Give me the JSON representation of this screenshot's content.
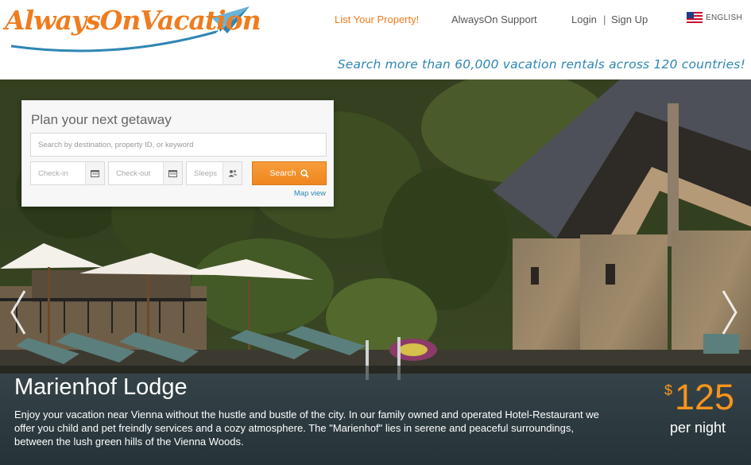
{
  "header": {
    "logo_text": "AlwaysOnVacation",
    "nav": {
      "list_property": "List Your Property!",
      "support": "AlwaysOn Support",
      "login": "Login",
      "separator": "|",
      "signup": "Sign Up"
    },
    "language": {
      "flag_icon": "us-flag-icon",
      "label": "ENGLISH"
    },
    "tagline": "Search more than 60,000 vacation rentals across 120 countries!"
  },
  "search_panel": {
    "title": "Plan your next getaway",
    "keyword_placeholder": "Search by destination, property ID, or keyword",
    "checkin_placeholder": "Check-in",
    "checkout_placeholder": "Check-out",
    "sleeps_placeholder": "Sleeps",
    "checkin_icon": "calendar-icon",
    "checkout_icon": "calendar-icon",
    "sleeps_icon": "people-icon",
    "search_button": "Search",
    "search_button_icon": "magnifier-icon",
    "map_view_link": "Map view"
  },
  "slideshow": {
    "prev_icon": "chevron-left-icon",
    "next_icon": "chevron-right-icon",
    "property_name": "Marienhof Lodge",
    "description": "Enjoy your vacation near Vienna without the hustle and bustle of the city. In our family owned and operated Hotel-Restaurant we offer you child and pet freindly services and a cozy atmosphere. The \"Marienhof\" lies in serene and peaceful surroundings, between the lush green hills of the Vienna Woods.",
    "currency": "$",
    "price": "125",
    "price_unit": "per night"
  },
  "colors": {
    "brand_orange": "#ef7c1f",
    "link_blue": "#2e86b4",
    "price_orange": "#f7941d"
  }
}
